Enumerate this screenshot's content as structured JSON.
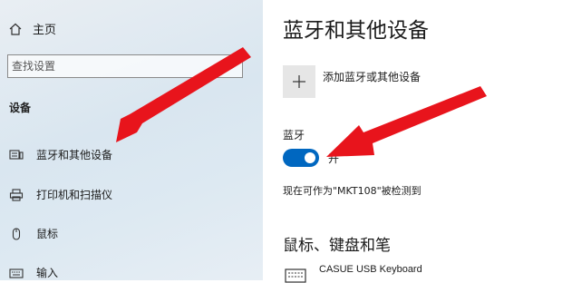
{
  "sidebar": {
    "home": "主页",
    "search_placeholder": "查找设置",
    "section": "设备",
    "items": [
      {
        "label": "蓝牙和其他设备",
        "icon": "bluetooth-devices-icon"
      },
      {
        "label": "打印机和扫描仪",
        "icon": "printer-icon"
      },
      {
        "label": "鼠标",
        "icon": "mouse-icon"
      },
      {
        "label": "输入",
        "icon": "keyboard-icon"
      }
    ]
  },
  "main": {
    "title": "蓝牙和其他设备",
    "add_device": "添加蓝牙或其他设备",
    "bluetooth_label": "蓝牙",
    "bluetooth_state": "开",
    "discoverable": "现在可作为\"MKT108\"被检测到",
    "section_title": "鼠标、键盘和笔",
    "device_name": "CASUE USB Keyboard"
  },
  "colors": {
    "accent": "#0067c0",
    "annotation_arrow": "#e8141c"
  }
}
